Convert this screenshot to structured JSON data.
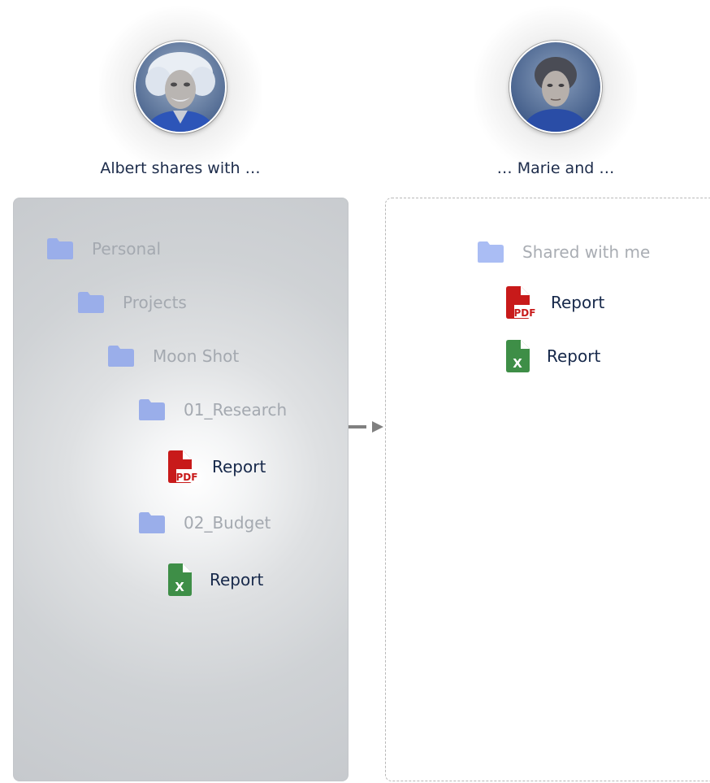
{
  "users": {
    "albert": {
      "caption": "Albert shares with …",
      "avatar_icon": "albert-einstein-portrait"
    },
    "marie": {
      "caption": "… Marie and …",
      "avatar_icon": "marie-curie-portrait"
    }
  },
  "albert_drive": {
    "items": [
      {
        "type": "folder",
        "label": "Personal",
        "icon": "folder-icon"
      },
      {
        "type": "folder",
        "label": "Projects",
        "icon": "folder-icon"
      },
      {
        "type": "folder",
        "label": "Moon Shot",
        "icon": "folder-icon"
      },
      {
        "type": "folder",
        "label": "01_Research",
        "icon": "folder-icon"
      },
      {
        "type": "file",
        "label": "Report",
        "icon": "pdf-file-icon"
      },
      {
        "type": "folder",
        "label": "02_Budget",
        "icon": "folder-icon"
      },
      {
        "type": "file",
        "label": "Report",
        "icon": "excel-file-icon"
      }
    ]
  },
  "marie_drive": {
    "items": [
      {
        "type": "folder",
        "label": "Shared with me",
        "icon": "folder-icon"
      },
      {
        "type": "file",
        "label": "Report",
        "icon": "pdf-file-icon"
      },
      {
        "type": "file",
        "label": "Report",
        "icon": "excel-file-icon"
      }
    ]
  },
  "icons": {
    "pdf_text": "PDF",
    "excel_text": "X"
  },
  "colors": {
    "folder_blue": "#9aaeea",
    "folder_blue_light": "#aabdf4",
    "pdf_red": "#c81a1a",
    "excel_green": "#3e8e47",
    "label_dark": "#16284a",
    "label_muted": "#a4a9b0"
  }
}
